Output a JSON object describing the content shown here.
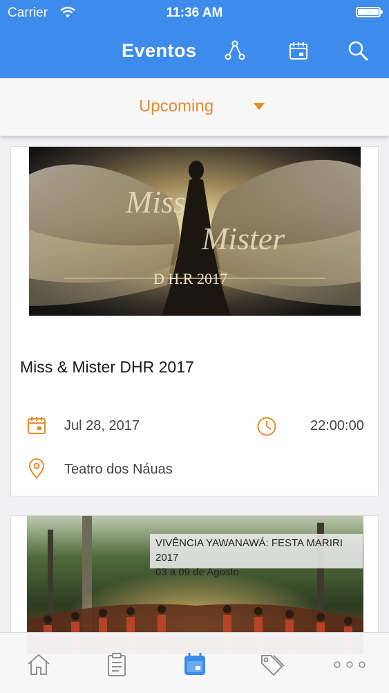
{
  "status_bar": {
    "carrier": "Carrier",
    "time": "11:36 AM"
  },
  "nav": {
    "title": "Eventos",
    "icons": [
      "share-network-icon",
      "calendar-icon",
      "search-icon"
    ]
  },
  "filter": {
    "selected": "Upcoming"
  },
  "events": [
    {
      "poster_text": "Miss Mister",
      "poster_subtitle": "D H.R 2017",
      "title": "Miss & Mister DHR 2017",
      "date": "Jul 28, 2017",
      "time": "22:00:00",
      "location": "Teatro dos Náuas"
    },
    {
      "caption_line1": "VIVÊNCIA YAWANAWÁ: FESTA MARIRI 2017",
      "caption_line2": "03 a 09 de Agosto"
    }
  ],
  "tabbar": {
    "tabs": [
      "home-icon",
      "clipboard-icon",
      "calendar-icon",
      "tags-icon",
      "more-icon"
    ],
    "active": "calendar-icon"
  },
  "colors": {
    "header_blue": "#3d8ceb",
    "accent_orange": "#e68a2e"
  }
}
